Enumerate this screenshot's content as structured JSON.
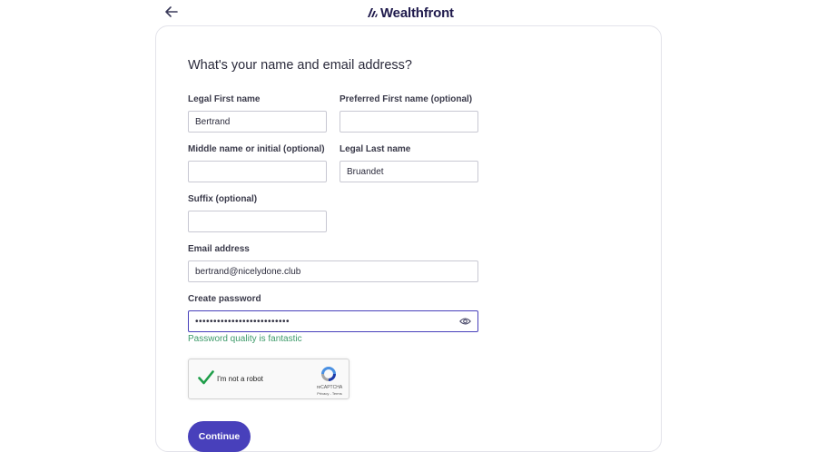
{
  "header": {
    "logo_text": "Wealthfront",
    "back_icon": "arrow-left-icon"
  },
  "form": {
    "title": "What's your name and email address?",
    "legal_first": {
      "label": "Legal First name",
      "value": "Bertrand"
    },
    "preferred_first": {
      "label": "Preferred First name (optional)",
      "value": ""
    },
    "middle": {
      "label": "Middle name or initial (optional)",
      "value": ""
    },
    "legal_last": {
      "label": "Legal Last name",
      "value": "Bruandet"
    },
    "suffix": {
      "label": "Suffix (optional)",
      "value": ""
    },
    "email": {
      "label": "Email address",
      "value": "bertrand@nicelydone.club"
    },
    "password": {
      "label": "Create password",
      "value": "••••••••••••••••••••••••••"
    },
    "password_quality": "Password quality is fantastic"
  },
  "captcha": {
    "text": "I'm not a robot",
    "brand": "reCAPTCHA",
    "links": "Privacy - Terms"
  },
  "continue_label": "Continue",
  "colors": {
    "brand": "#4840bb",
    "success": "#3d9a6a",
    "logo": "#1f1a4c"
  }
}
